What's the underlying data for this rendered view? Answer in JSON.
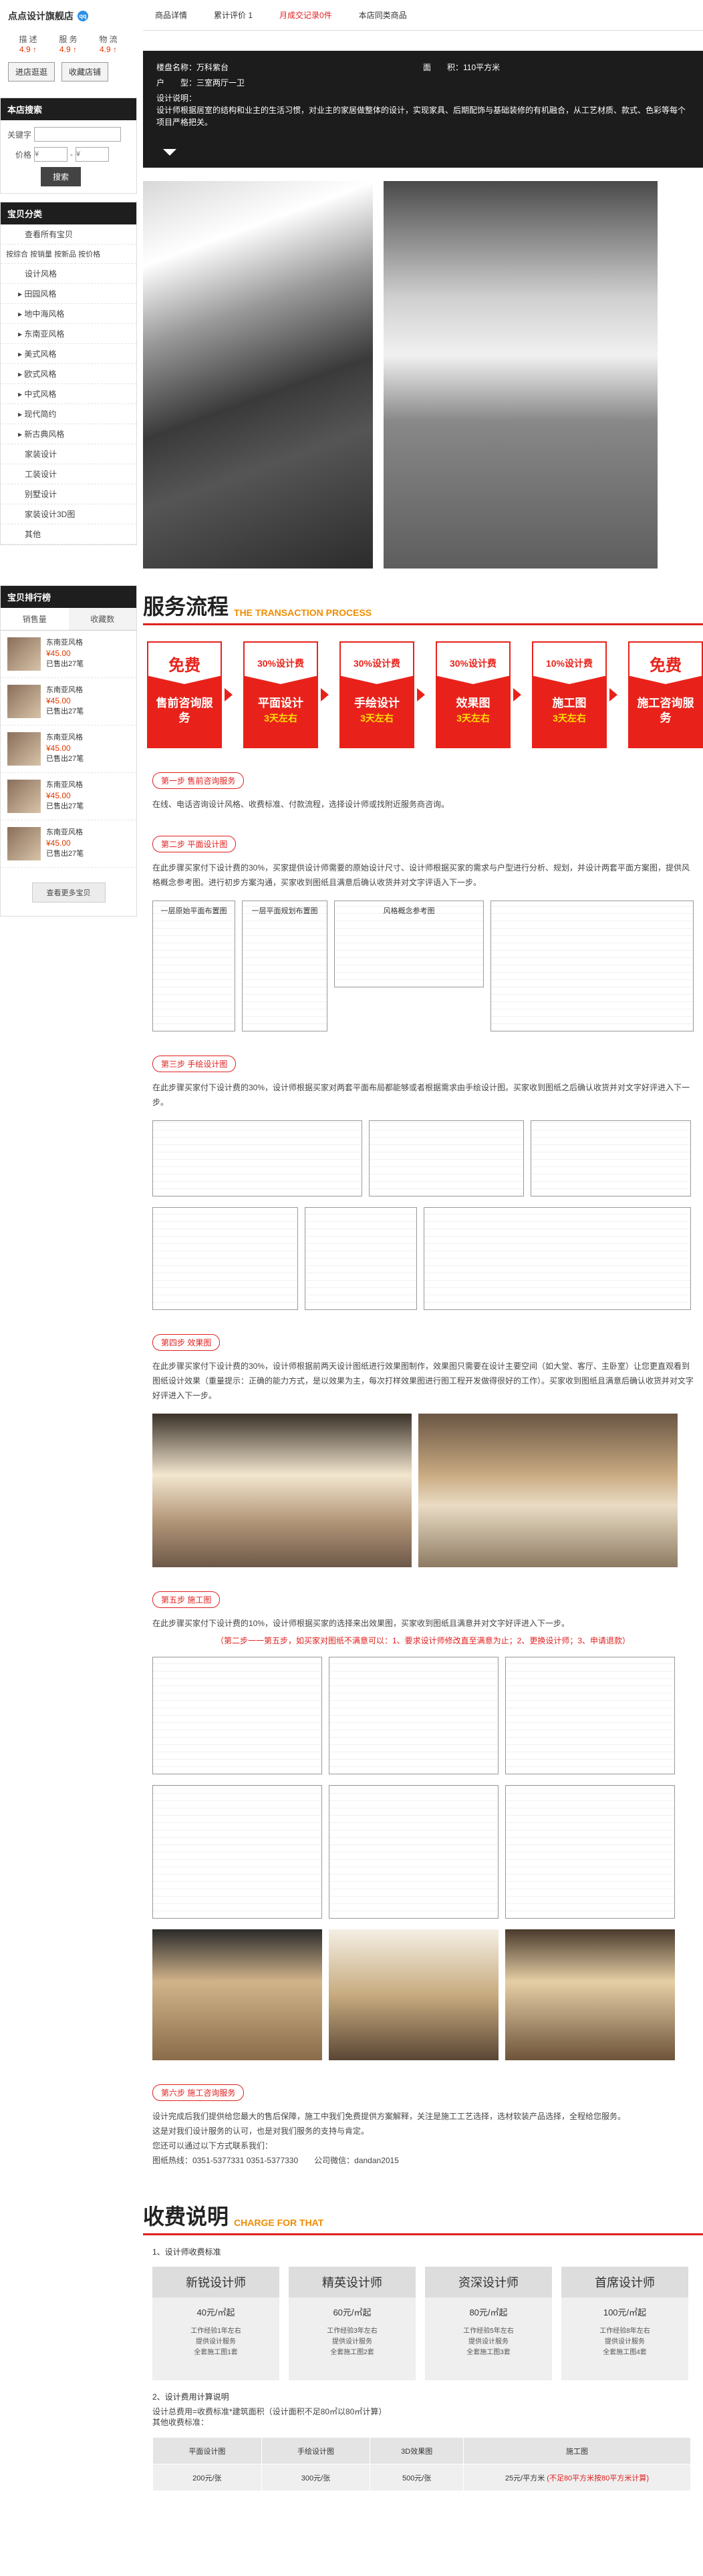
{
  "sidebar": {
    "shop_name": "点点设计旗舰店",
    "qq_icon": "qq",
    "ratings": [
      {
        "label": "描 述",
        "score": "4.9 ↑"
      },
      {
        "label": "服 务",
        "score": "4.9 ↑"
      },
      {
        "label": "物 流",
        "score": "4.9 ↑"
      }
    ],
    "enter_shop": "进店逛逛",
    "favorite_shop": "收藏店铺",
    "search_title": "本店搜索",
    "keyword_label": "关键字",
    "price_label": "价格",
    "price_sep": "-",
    "price_from_ph": "¥",
    "price_to_ph": "¥",
    "search_button": "搜索",
    "category_title": "宝贝分类",
    "categories": {
      "view_all": "查看所有宝贝",
      "sort_options": "按综合 按销量 按新品 按价格",
      "design_style": "设计风格",
      "styles": [
        "田园风格",
        "地中海风格",
        "东南亚风格",
        "美式风格",
        "欧式风格",
        "中式风格",
        "现代简约",
        "新古典风格"
      ],
      "others": [
        "家装设计",
        "工装设计",
        "别墅设计",
        "家装设计3D图",
        "其他"
      ]
    },
    "rank_title": "宝贝排行榜",
    "rank_tabs": [
      "销售量",
      "收藏数"
    ],
    "rank_items": [
      {
        "name": "东南亚风格",
        "price": "¥45.00",
        "sold": "已售出27笔"
      },
      {
        "name": "东南亚风格",
        "price": "¥45.00",
        "sold": "已售出27笔"
      },
      {
        "name": "东南亚风格",
        "price": "¥45.00",
        "sold": "已售出27笔"
      },
      {
        "name": "东南亚风格",
        "price": "¥45.00",
        "sold": "已售出27笔"
      },
      {
        "name": "东南亚风格",
        "price": "¥45.00",
        "sold": "已售出27笔"
      }
    ],
    "more_button": "查看更多宝贝"
  },
  "nav": {
    "tabs": [
      "商品详情",
      "累计评价 1",
      "月成交记录0件",
      "本店同类商品"
    ]
  },
  "info": {
    "community_label": "楼盘名称：万科紫台",
    "area_label": "面　　积：110平方米",
    "layout_label": "户　　型：三室两厅一卫",
    "desc_title": "设计说明：",
    "desc": "设计师根据居室的结构和业主的生活习惯，对业主的家居做整体的设计，实现家具、后期配饰与基础装修的有机融合，从工艺材质、款式、色彩等每个项目严格把关。"
  },
  "flow": {
    "title": "服务流程",
    "subtitle": "THE TRANSACTION PROCESS",
    "steps": [
      {
        "badge": "免费",
        "name": "售前咨询服务",
        "days": ""
      },
      {
        "badge": "30%设计费",
        "name": "平面设计",
        "days": "3天左右"
      },
      {
        "badge": "30%设计费",
        "name": "手绘设计",
        "days": "3天左右"
      },
      {
        "badge": "30%设计费",
        "name": "效果图",
        "days": "3天左右"
      },
      {
        "badge": "10%设计费",
        "name": "施工图",
        "days": "3天左右"
      },
      {
        "badge": "免费",
        "name": "施工咨询服务",
        "days": ""
      }
    ]
  },
  "steps": {
    "s1_head": "第一步 售前咨询服务",
    "s1_text": "在线、电话咨询设计风格、收费标准、付款流程，选择设计师或找附近服务商咨询。",
    "s2_head": "第二步 平面设计图",
    "s2_text": "在此步骤买家付下设计费的30%，买家提供设计师需要的原始设计尺寸、设计师根据买家的需求与户型进行分析、规划，并设计两套平面方案图，提供风格概念参考图。进行初步方案沟通，买家收到图纸且满意后确认收货并对文字评语入下一步。",
    "s2_labels": [
      "一层原始平面布置图",
      "一层平面规划布置图",
      "风格概念参考图"
    ],
    "s3_head": "第三步 手绘设计图",
    "s3_text": "在此步骤买家付下设计费的30%，设计师根据买家对两套平面布局都能够或者根据需求由手绘设计图。买家收到图纸之后确认收货并对文字好评进入下一步。",
    "s4_head": "第四步 效果图",
    "s4_text": "在此步骤买家付下设计费的30%，设计师根据前两天设计图纸进行效果图制作，效果图只需要在设计主要空间（如大堂、客厅、主卧室）让您更直观看到图纸设计效果（重量提示：正确的能力方式，是以效果为主，每次打样效果图进行图工程开发做得很好的工作）。买家收到图纸且满意后确认收货并对文字好评进入下一步。",
    "s5_head": "第五步 施工图",
    "s5_text": "在此步骤买家付下设计费的10%，设计师根据买家的选择来出效果图，买家收到图纸且满意并对文字好评进入下一步。",
    "s5_red": "（第二步一一第五步，如买家对图纸不满意可以：1、要求设计师修改直至满意为止；2、更换设计师；3、申请退款）",
    "s6_head": "第六步 施工咨询服务",
    "s6_text1": "设计完成后我们提供给您最大的售后保障，施工中我们免费提供方案解释，关注是施工工艺选择，选材软装产品选择，全程给您服务。",
    "s6_text2": "这是对我们设计服务的认可，也是对我们服务的支持与肯定。",
    "s6_text3": "您还可以通过以下方式联系我们：",
    "s6_contact": "图纸热线：0351-5377331  0351-5377330　　公司微信：dandan2015"
  },
  "fee": {
    "title": "收费说明",
    "subtitle": "CHARGE FOR THAT",
    "standard_title": "1、设计师收费标准",
    "cards": [
      {
        "name": "新锐设计师",
        "price": "40元/㎡起",
        "desc": [
          "工作经验1年左右",
          "提供设计服务",
          "全套施工图1套"
        ]
      },
      {
        "name": "精英设计师",
        "price": "60元/㎡起",
        "desc": [
          "工作经验3年左右",
          "提供设计服务",
          "全套施工图2套"
        ]
      },
      {
        "name": "资深设计师",
        "price": "80元/㎡起",
        "desc": [
          "工作经验5年左右",
          "提供设计服务",
          "全套施工图3套"
        ]
      },
      {
        "name": "首席设计师",
        "price": "100元/㎡起",
        "desc": [
          "工作经验8年左右",
          "提供设计服务",
          "全套施工图4套"
        ]
      }
    ],
    "calc_title": "2、设计费用计算说明",
    "calc_formula": "设计总费用=收费标准*建筑面积（设计面积不足80㎡以80㎡计算）",
    "calc_note": "其他收费标准：",
    "table_head": [
      "平面设计图",
      "手绘设计图",
      "3D效果图",
      "施工图"
    ],
    "table_row": [
      "200元/张",
      "300元/张",
      "500元/张",
      "25元/平方米"
    ],
    "table_note": "(不足80平方米按80平方米计算)"
  }
}
